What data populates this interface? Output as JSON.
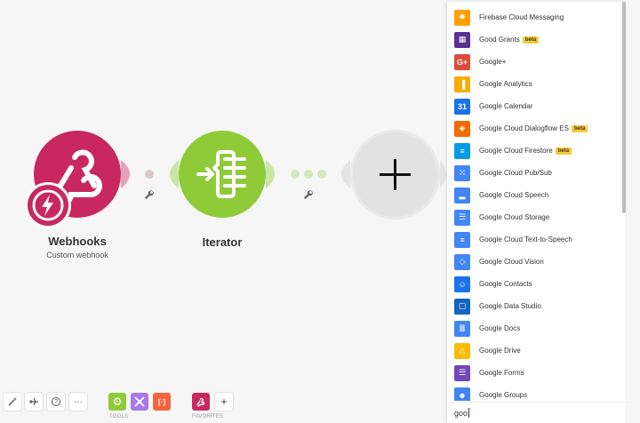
{
  "scenario": {
    "modules": [
      {
        "title": "Webhooks",
        "subtitle": "Custom webhook",
        "color": "#c8285f",
        "icon": "webhook-icon"
      },
      {
        "title": "Iterator",
        "subtitle": "",
        "color": "#8fcb39",
        "icon": "iterator-icon"
      },
      {
        "title": "",
        "subtitle": "",
        "color": "#e2e2e2",
        "icon": "plus-icon"
      }
    ],
    "badge_icon": "lightning-icon",
    "link_icon": "wrench-icon"
  },
  "toolbar": {
    "left_buttons": [
      "magic-wand-icon",
      "airplane-icon",
      "help-icon",
      "more-icon"
    ],
    "more_label": "···",
    "help_label": "?",
    "tools_caption": "TOOLS",
    "favorites_caption": "FAVORITES",
    "add_label": "+",
    "tools": [
      {
        "name": "gear-icon",
        "color": "#8fcb39"
      },
      {
        "name": "flow-control-icon",
        "color": "#a779e9"
      },
      {
        "name": "text-parser-icon",
        "color": "#f4633c",
        "label": "[·]"
      }
    ]
  },
  "app_picker": {
    "search_value": "goo",
    "beta_label": "beta",
    "items": [
      {
        "label": "Firebase Cloud Messaging",
        "color": "#ffa000",
        "icon": "firebase-icon",
        "glyph": "✸",
        "beta": false
      },
      {
        "label": "Good Grants",
        "color": "#5b2e91",
        "icon": "good-grants-icon",
        "glyph": "▦",
        "beta": true
      },
      {
        "label": "Google+",
        "color": "#dd4b39",
        "icon": "google-plus-icon",
        "glyph": "G+",
        "beta": false
      },
      {
        "label": "Google Analytics",
        "color": "#f9ab00",
        "icon": "google-analytics-icon",
        "glyph": "▐",
        "beta": false
      },
      {
        "label": "Google Calendar",
        "color": "#1a73e8",
        "icon": "google-calendar-icon",
        "glyph": "31",
        "beta": false
      },
      {
        "label": "Google Cloud Dialogflow ES",
        "color": "#ef6c00",
        "icon": "dialogflow-icon",
        "glyph": "◈",
        "beta": true
      },
      {
        "label": "Google Cloud Firestore",
        "color": "#039be5",
        "icon": "firestore-icon",
        "glyph": "≡",
        "beta": true
      },
      {
        "label": "Google Cloud Pub/Sub",
        "color": "#4285f4",
        "icon": "pubsub-icon",
        "glyph": "⁙",
        "beta": false
      },
      {
        "label": "Google Cloud Speech",
        "color": "#4285f4",
        "icon": "cloud-speech-icon",
        "glyph": "▂",
        "beta": false
      },
      {
        "label": "Google Cloud Storage",
        "color": "#4285f4",
        "icon": "cloud-storage-icon",
        "glyph": "☰",
        "beta": false
      },
      {
        "label": "Google Cloud Text-to-Speech",
        "color": "#4285f4",
        "icon": "text-to-speech-icon",
        "glyph": "≡",
        "beta": false
      },
      {
        "label": "Google Cloud Vision",
        "color": "#4285f4",
        "icon": "cloud-vision-icon",
        "glyph": "◇",
        "beta": false
      },
      {
        "label": "Google Contacts",
        "color": "#1a73e8",
        "icon": "google-contacts-icon",
        "glyph": "☺",
        "beta": false
      },
      {
        "label": "Google Data Studio",
        "color": "#1565c0",
        "icon": "data-studio-icon",
        "glyph": "▢",
        "beta": false
      },
      {
        "label": "Google Docs",
        "color": "#4285f4",
        "icon": "google-docs-icon",
        "glyph": "≣",
        "beta": false
      },
      {
        "label": "Google Drive",
        "color": "#fbbc04",
        "icon": "google-drive-icon",
        "glyph": "△",
        "beta": false
      },
      {
        "label": "Google Forms",
        "color": "#7248b9",
        "icon": "google-forms-icon",
        "glyph": "☰",
        "beta": false
      },
      {
        "label": "Google Groups",
        "color": "#4285f4",
        "icon": "google-groups-icon",
        "glyph": "☻",
        "beta": false
      }
    ]
  }
}
